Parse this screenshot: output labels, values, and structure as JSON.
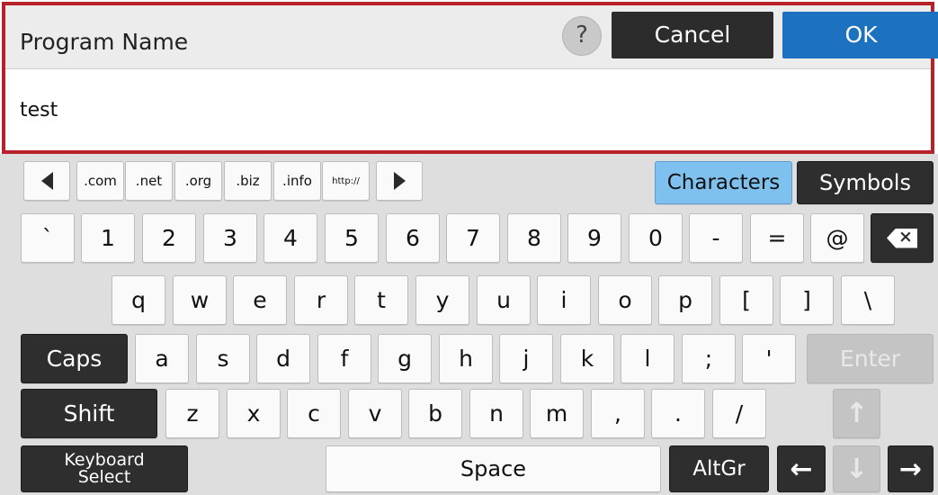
{
  "dialog": {
    "title": "Program Name",
    "help_label": "?",
    "cancel_label": "Cancel",
    "ok_label": "OK",
    "input_value": "test"
  },
  "keyboard": {
    "tab_characters": "Characters",
    "tab_symbols": "Symbols",
    "domains": [
      ".com",
      ".net",
      ".org",
      ".biz",
      ".info",
      "http://"
    ],
    "row_numbers": [
      "`",
      "1",
      "2",
      "3",
      "4",
      "5",
      "6",
      "7",
      "8",
      "9",
      "0",
      "-",
      "=",
      "@"
    ],
    "row_qwerty": [
      "q",
      "w",
      "e",
      "r",
      "t",
      "y",
      "u",
      "i",
      "o",
      "p",
      "[",
      "]",
      "\\"
    ],
    "row_asdf": [
      "a",
      "s",
      "d",
      "f",
      "g",
      "h",
      "j",
      "k",
      "l",
      ";",
      "'"
    ],
    "row_zxcv": [
      "z",
      "x",
      "c",
      "v",
      "b",
      "n",
      "m",
      ",",
      ".",
      "/"
    ],
    "caps_label": "Caps",
    "enter_label": "Enter",
    "shift_label": "Shift",
    "keyboard_select_line1": "Keyboard",
    "keyboard_select_line2": "Select",
    "space_label": "Space",
    "altgr_label": "AltGr",
    "icons": {
      "backspace": "backspace-icon",
      "prev": "triangle-left-icon",
      "next": "triangle-right-icon",
      "up": "arrow-up-icon",
      "down": "arrow-down-icon",
      "left": "arrow-left-icon",
      "right": "arrow-right-icon"
    }
  }
}
